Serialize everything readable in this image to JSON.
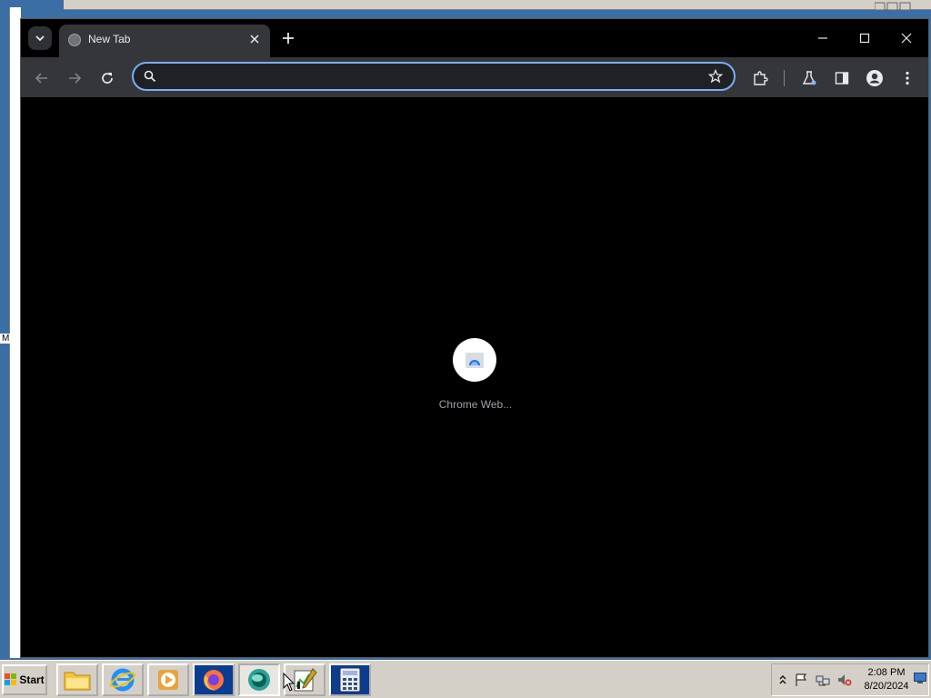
{
  "browser": {
    "tab": {
      "title": "New Tab",
      "favicon": "globe-icon"
    },
    "toolbar": {
      "omnibox_value": "",
      "icons": [
        "back-arrow-icon",
        "forward-arrow-icon",
        "reload-icon",
        "search-icon",
        "star-icon",
        "extensions-icon",
        "labs-flask-icon",
        "side-panel-icon",
        "profile-icon",
        "menu-icon"
      ]
    },
    "content": {
      "loading_label": "Chrome Web..."
    }
  },
  "background_window": {
    "label": "M"
  },
  "taskbar": {
    "start_label": "Start",
    "apps": [
      "file-explorer",
      "internet-explorer",
      "media-player",
      "firefox",
      "chrome-beta",
      "task-manager",
      "calculator"
    ],
    "clock_time": "2:08 PM",
    "clock_date": "8/20/2024"
  },
  "colors": {
    "accent_focus_ring": "#7cacf8",
    "toolbar_bg": "#35363a",
    "content_bg": "#000000",
    "taskbar_bg": "#d4d0c8"
  }
}
